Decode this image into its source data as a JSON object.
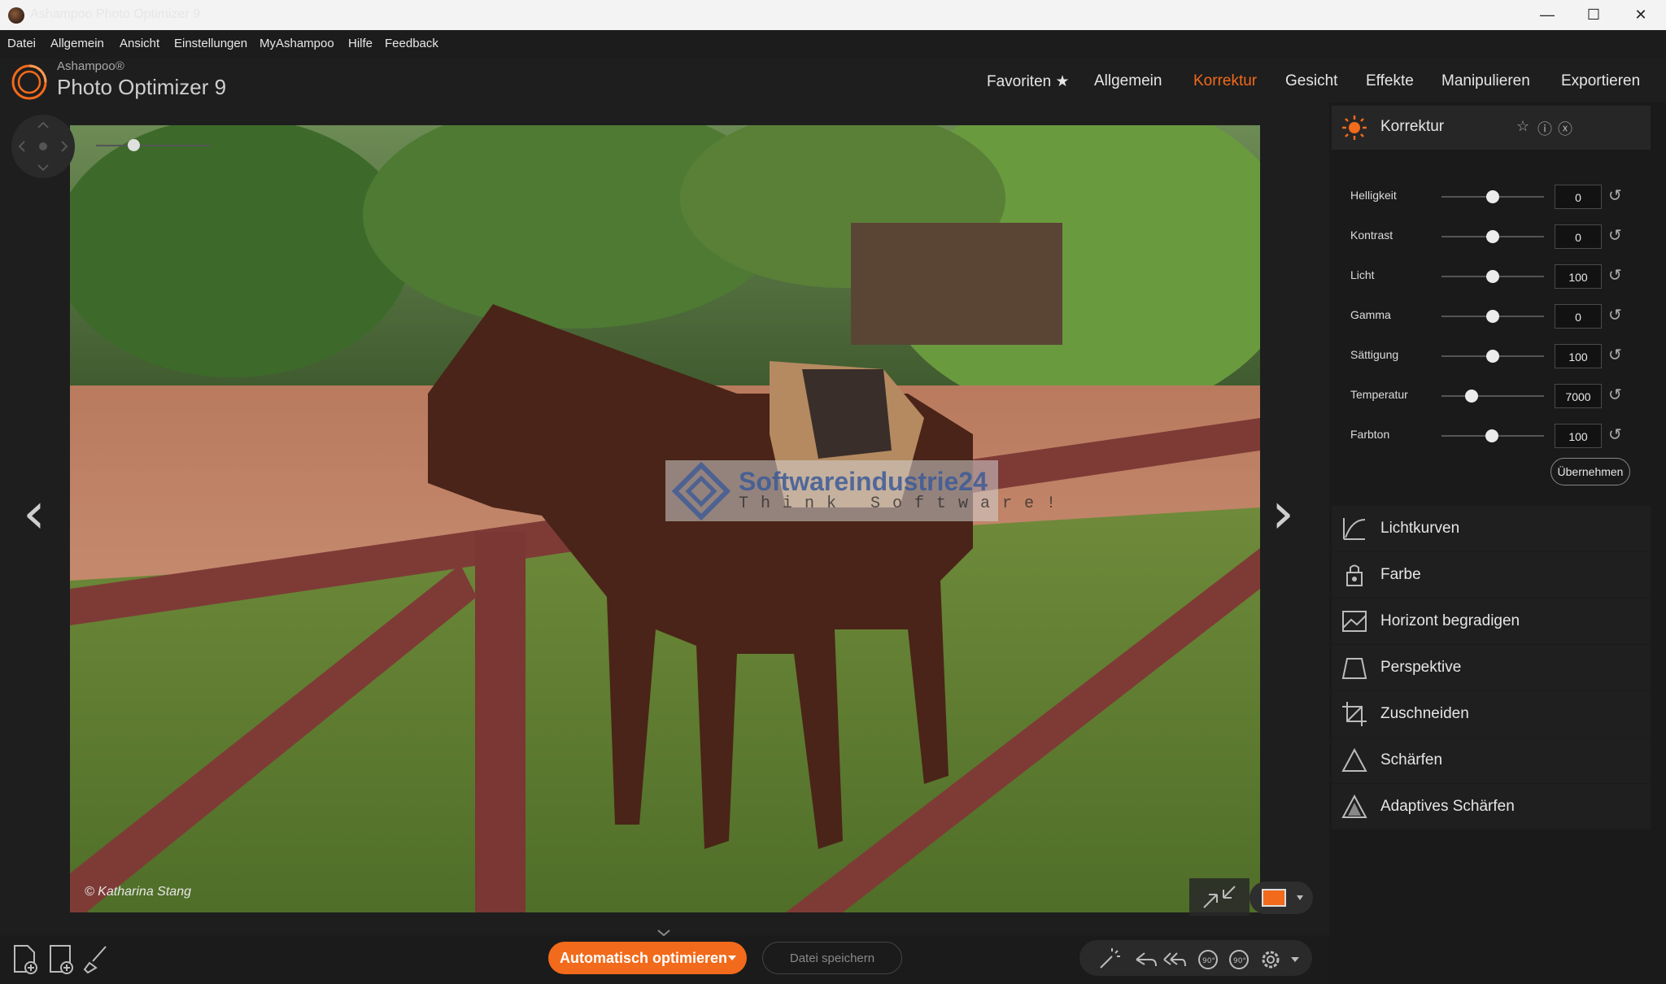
{
  "window": {
    "title": "Ashampoo Photo Optimizer 9",
    "minimize": "—",
    "maximize": "☐",
    "close": "✕"
  },
  "menu": [
    "Datei",
    "Allgemein",
    "Ansicht",
    "Einstellungen",
    "MyAshampoo",
    "Hilfe",
    "Feedback"
  ],
  "logo": {
    "brand": "Ashampoo®",
    "product": "Photo Optimizer 9"
  },
  "nav": [
    "Favoriten ★",
    "Allgemein",
    "Korrektur",
    "Gesicht",
    "Effekte",
    "Manipulieren",
    "Exportieren"
  ],
  "nav_active": "Korrektur",
  "photo": {
    "copyright": "© Katharina Stang",
    "watermark_title": "Softwareindustrie24",
    "watermark_sub": "Think Software!"
  },
  "panel": {
    "title": "Korrektur",
    "sliders": [
      {
        "label": "Helligkeit",
        "value": "0",
        "pos": 0.5
      },
      {
        "label": "Kontrast",
        "value": "0",
        "pos": 0.5
      },
      {
        "label": "Licht",
        "value": "100",
        "pos": 0.5
      },
      {
        "label": "Gamma",
        "value": "0",
        "pos": 0.5
      },
      {
        "label": "Sättigung",
        "value": "100",
        "pos": 0.5
      },
      {
        "label": "Temperatur",
        "value": "7000",
        "pos": 0.29
      },
      {
        "label": "Farbton",
        "value": "100",
        "pos": 0.49
      }
    ],
    "apply": "Übernehmen",
    "tools": [
      {
        "label": "Lichtkurven",
        "icon": "curve-icon"
      },
      {
        "label": "Farbe",
        "icon": "paint-bucket-icon"
      },
      {
        "label": "Horizont begradigen",
        "icon": "horizon-icon"
      },
      {
        "label": "Perspektive",
        "icon": "perspective-icon"
      },
      {
        "label": "Zuschneiden",
        "icon": "crop-icon"
      },
      {
        "label": "Schärfen",
        "icon": "sharpen-icon"
      },
      {
        "label": "Adaptives Schärfen",
        "icon": "adaptive-sharpen-icon"
      }
    ]
  },
  "bottom": {
    "auto": "Automatisch optimieren",
    "save": "Datei speichern"
  },
  "colors": {
    "accent": "#f26a1b",
    "background": "#1e1e1e",
    "panel": "#1a1a1a"
  }
}
